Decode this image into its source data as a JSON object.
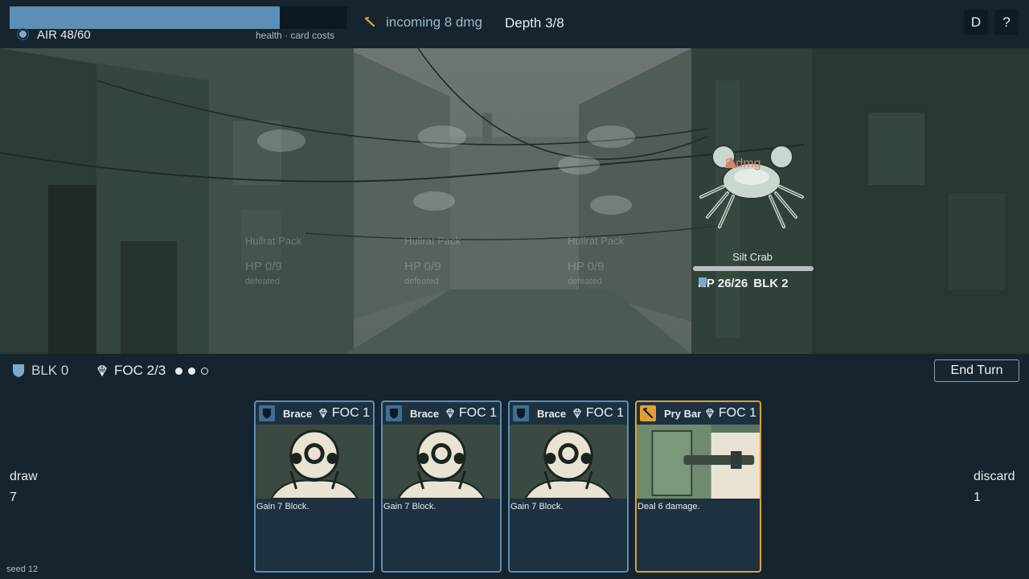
{
  "hud": {
    "air_label": "AIR 48/60",
    "air_current": 48,
    "air_max": 60,
    "air_sub": "health · card costs",
    "incoming": "incoming 8 dmg",
    "depth": "Depth 3/8",
    "deck_button": "D",
    "help_button": "?"
  },
  "enemies": [
    {
      "name": "Hullrat Pack",
      "hp": "HP 0/9",
      "state": "defeated"
    },
    {
      "name": "Hullrat Pack",
      "hp": "HP 0/9",
      "state": "defeated"
    },
    {
      "name": "Hullrat Pack",
      "hp": "HP 0/9",
      "state": "defeated"
    }
  ],
  "target": {
    "name": "Silt Crab",
    "intent": "8 dmg",
    "hp": "HP 26/26",
    "hp_current": 26,
    "hp_max": 26,
    "block": "BLK 2"
  },
  "player": {
    "block": "BLK 0",
    "focus": "FOC 2/3",
    "focus_current": 2,
    "focus_max": 3
  },
  "end_turn_label": "End Turn",
  "piles": {
    "draw_label": "draw",
    "draw_count": "7",
    "discard_label": "discard",
    "discard_count": "1"
  },
  "hand": [
    {
      "name": "Brace",
      "cost": "FOC 1",
      "type": "skill",
      "type_icon": "shield-icon",
      "text": "Gain 7 Block."
    },
    {
      "name": "Brace",
      "cost": "FOC 1",
      "type": "skill",
      "type_icon": "shield-icon",
      "text": "Gain 7 Block."
    },
    {
      "name": "Brace",
      "cost": "FOC 1",
      "type": "skill",
      "type_icon": "shield-icon",
      "text": "Gain 7 Block."
    },
    {
      "name": "Pry Bar",
      "cost": "FOC 1",
      "type": "attack",
      "type_icon": "crowbar-icon",
      "text": "Deal 6 damage."
    }
  ],
  "seed": "seed 12",
  "colors": {
    "air_fill": "#5d8eb5",
    "skill_border": "#5d8eb5",
    "attack_border": "#e0a032",
    "intent": "#d8806a"
  }
}
